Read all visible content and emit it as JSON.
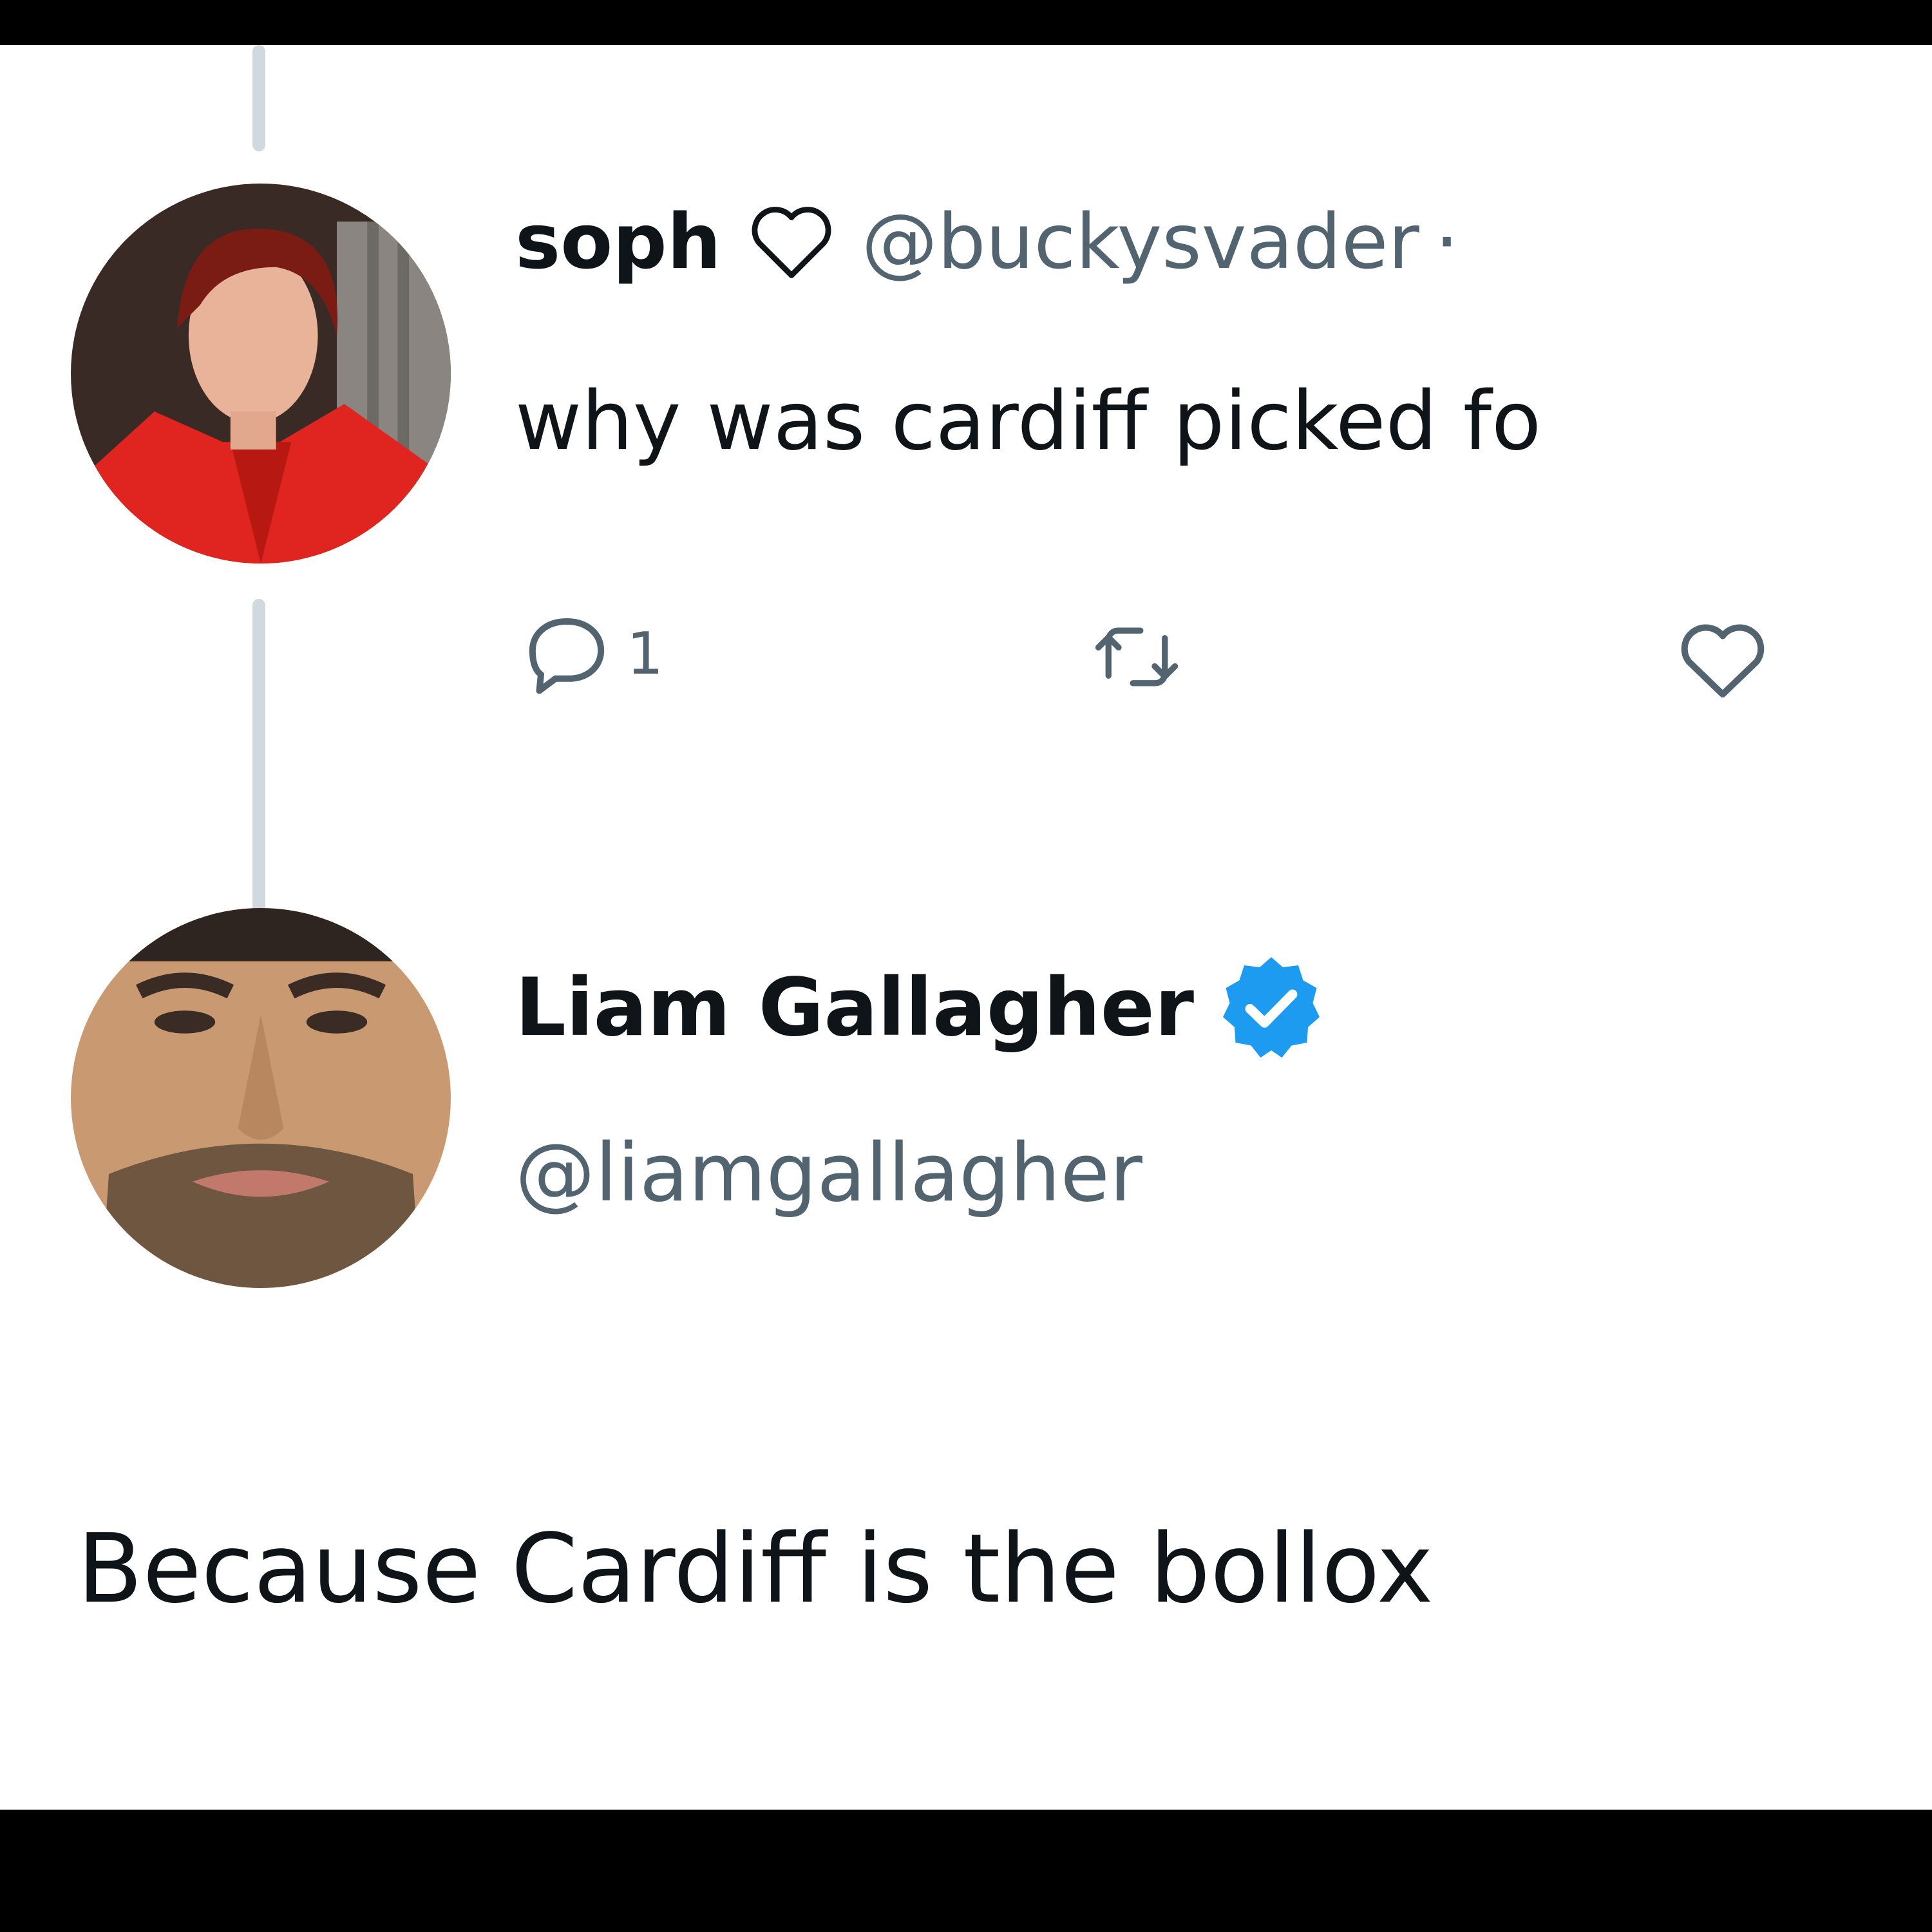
{
  "reply_tweet": {
    "display_name": "soph",
    "handle": "@buckysvader",
    "separator": "·",
    "text": "why was cardiff picked fo",
    "reply_count": "1"
  },
  "main_tweet": {
    "display_name": "Liam Gallagher",
    "handle": "@liamgallagher",
    "text": "Because Cardiff is the bollox"
  },
  "colors": {
    "primary_text": "#0f1419",
    "secondary_text": "#536471",
    "verified_badge": "#1d9bf0",
    "thread_line": "#cfd9de"
  },
  "icons": [
    "heart-outline-icon",
    "reply-icon",
    "retweet-icon",
    "like-icon",
    "verified-badge-icon"
  ]
}
